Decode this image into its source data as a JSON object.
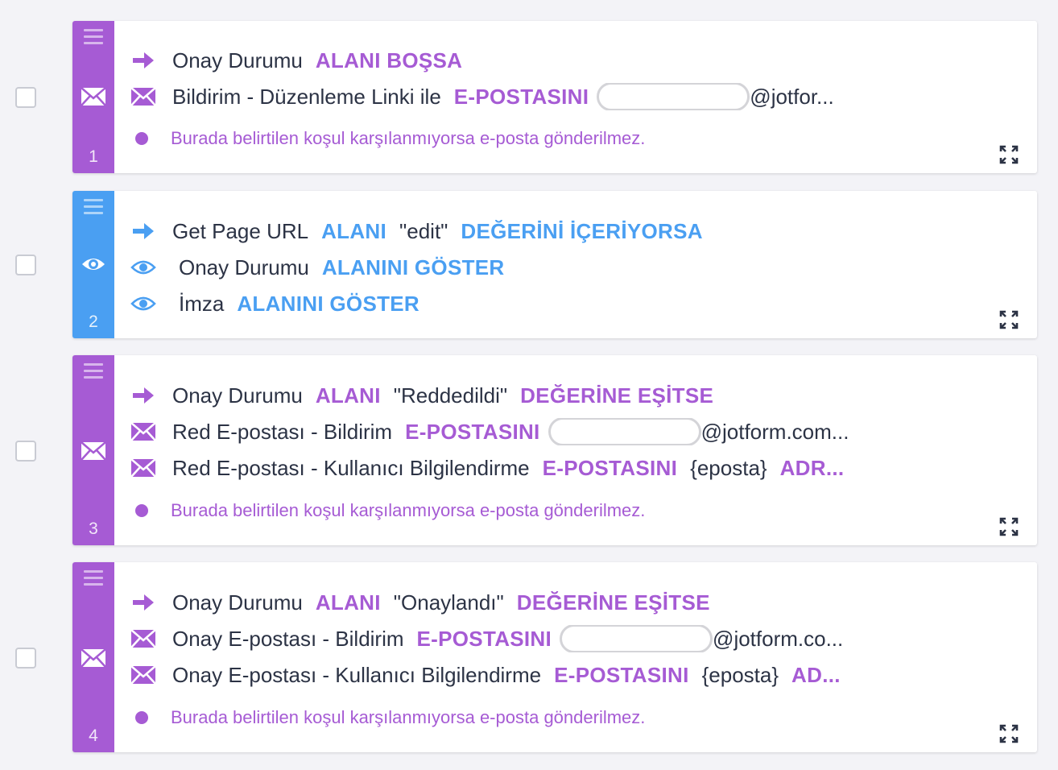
{
  "conditions": [
    {
      "number": "1",
      "color": "purple",
      "side_icon": "envelope-icon",
      "lines": [
        {
          "icon": "arrow-right-icon",
          "text": "Onay Durumu",
          "keyword": "ALANI BOŞSA"
        },
        {
          "icon": "envelope-icon",
          "text": "Bildirim - Düzenleme Linki ile",
          "keyword": "E-POSTASINI",
          "domain": "@jotfor..."
        }
      ],
      "note": "Burada belirtilen koşul karşılanmıyorsa e-posta gönderilmez."
    },
    {
      "number": "2",
      "color": "blue",
      "side_icon": "eye-icon",
      "lines": [
        {
          "icon": "arrow-right-icon",
          "text": "Get Page URL",
          "keyword": "ALANI",
          "value": "\"edit\"",
          "keyword2": "DEĞERİNİ İÇERİYORSA"
        },
        {
          "icon": "eye-icon",
          "text": "Onay Durumu",
          "keyword": "ALANINI GÖSTER"
        },
        {
          "icon": "eye-icon",
          "text": "İmza",
          "keyword": "ALANINI GÖSTER"
        }
      ]
    },
    {
      "number": "3",
      "color": "purple",
      "side_icon": "envelope-icon",
      "lines": [
        {
          "icon": "arrow-right-icon",
          "text": "Onay Durumu",
          "keyword": "ALANI",
          "value": "\"Reddedildi\"",
          "keyword2": "DEĞERİNE EŞİTSE"
        },
        {
          "icon": "envelope-icon",
          "text": "Red E-postası - Bildirim",
          "keyword": "E-POSTASINI",
          "domain": "@jotform.com..."
        },
        {
          "icon": "envelope-icon",
          "text": "Red E-postası - Kullanıcı Bilgilendirme",
          "keyword": "E-POSTASINI",
          "value": "{eposta}",
          "keyword2": "ADR..."
        }
      ],
      "note": "Burada belirtilen koşul karşılanmıyorsa e-posta gönderilmez."
    },
    {
      "number": "4",
      "color": "purple",
      "side_icon": "envelope-icon",
      "lines": [
        {
          "icon": "arrow-right-icon",
          "text": "Onay Durumu",
          "keyword": "ALANI",
          "value": "\"Onaylandı\"",
          "keyword2": "DEĞERİNE EŞİTSE"
        },
        {
          "icon": "envelope-icon",
          "text": "Onay E-postası - Bildirim",
          "keyword": "E-POSTASINI",
          "domain": "@jotform.co..."
        },
        {
          "icon": "envelope-icon",
          "text": "Onay E-postası - Kullanıcı Bilgilendirme",
          "keyword": "E-POSTASINI",
          "value": "{eposta}",
          "keyword2": "AD..."
        }
      ],
      "note": "Burada belirtilen koşul karşılanmıyorsa e-posta gönderilmez."
    }
  ],
  "colors": {
    "purple": "#a65bd4",
    "blue": "#4a9ff2",
    "text": "#2c3345"
  }
}
